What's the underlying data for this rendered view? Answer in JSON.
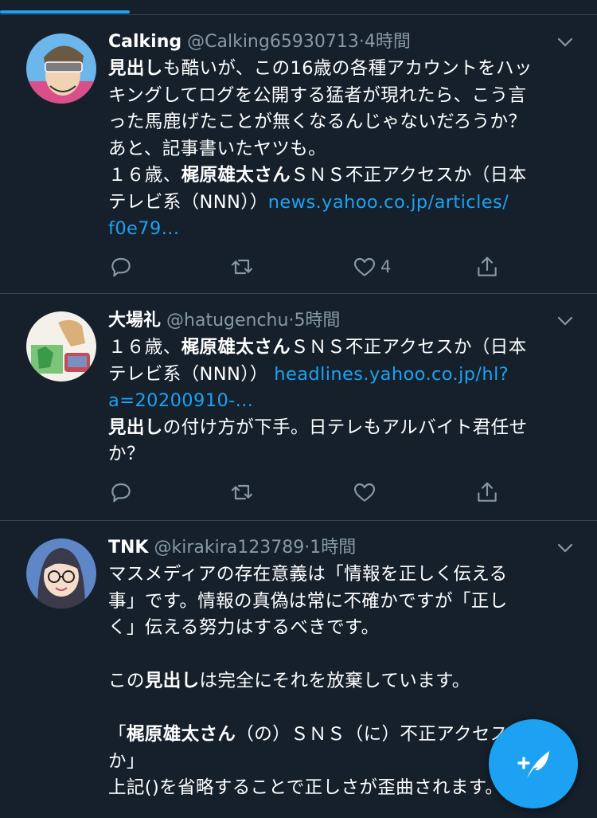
{
  "colors": {
    "background": "#15202b",
    "accent": "#1da1f2",
    "muted": "#8899a6",
    "divider": "#38444d"
  },
  "tweets": [
    {
      "name": "Calking",
      "handle": "@Calking65930713",
      "sep": "·",
      "time": "4時間",
      "lines": [
        [
          {
            "b": "見出し"
          },
          {
            "t": "も酷いが、この16歳の各種アカウントをハッ"
          }
        ],
        [
          {
            "t": "キングしてログを公開する猛者が現れたら、こう言"
          }
        ],
        [
          {
            "t": "った馬鹿げたことが無くなるんじゃないだろうか？"
          }
        ],
        [
          {
            "t": "あと、記事書いたヤツも。"
          }
        ],
        [
          {
            "t": "１６歳、"
          },
          {
            "b": "梶原雄太さん"
          },
          {
            "t": "ＳＮＳ不正アクセスか（日本"
          }
        ],
        [
          {
            "t": "テレビ系（NNN））"
          },
          {
            "l": "news.yahoo.co.jp/articles/"
          }
        ],
        [
          {
            "l": "f0e79..."
          }
        ]
      ],
      "like_count": "4",
      "icons": [
        "reply-icon",
        "retweet-icon",
        "like-icon",
        "share-icon"
      ]
    },
    {
      "name": "大場礼",
      "handle": "@hatugenchu",
      "sep": "·",
      "time": "5時間",
      "lines": [
        [
          {
            "t": "１６歳、"
          },
          {
            "b": "梶原雄太さん"
          },
          {
            "t": "ＳＮＳ不正アクセスか（日本"
          }
        ],
        [
          {
            "t": "テレビ系（NNN）） "
          },
          {
            "l": "headlines.yahoo.co.jp/hl?"
          }
        ],
        [
          {
            "l": "a=20200910-..."
          }
        ],
        [
          {
            "b": "見出し"
          },
          {
            "t": "の付け方が下手。日テレもアルバイト君任せ"
          }
        ],
        [
          {
            "t": "か？"
          }
        ]
      ],
      "like_count": "",
      "icons": [
        "reply-icon",
        "retweet-icon",
        "like-icon",
        "share-icon"
      ]
    },
    {
      "name": "TNK",
      "handle": "@kirakira123789",
      "sep": "·",
      "time": "1時間",
      "lines": [
        [
          {
            "t": "マスメディアの存在意義は「情報を正しく伝える"
          }
        ],
        [
          {
            "t": "事」です。情報の真偽は常に不確かですが「正し"
          }
        ],
        [
          {
            "t": "く」伝える努力はするべきです。"
          }
        ],
        [
          {
            "t": ""
          }
        ],
        [
          {
            "t": "この"
          },
          {
            "b": "見出し"
          },
          {
            "t": "は完全にそれを放棄しています。"
          }
        ],
        [
          {
            "t": ""
          }
        ],
        [
          {
            "t": "「"
          },
          {
            "b": "梶原雄太さん"
          },
          {
            "t": "（の）ＳＮＳ（に）不正アクセス"
          }
        ],
        [
          {
            "t": "か」"
          }
        ],
        [
          {
            "t": "上記()を省略することで正しさが歪曲されます。"
          }
        ]
      ],
      "like_count": "",
      "icons": []
    }
  ],
  "compose_button": {
    "icon": "compose-tweet-icon"
  }
}
